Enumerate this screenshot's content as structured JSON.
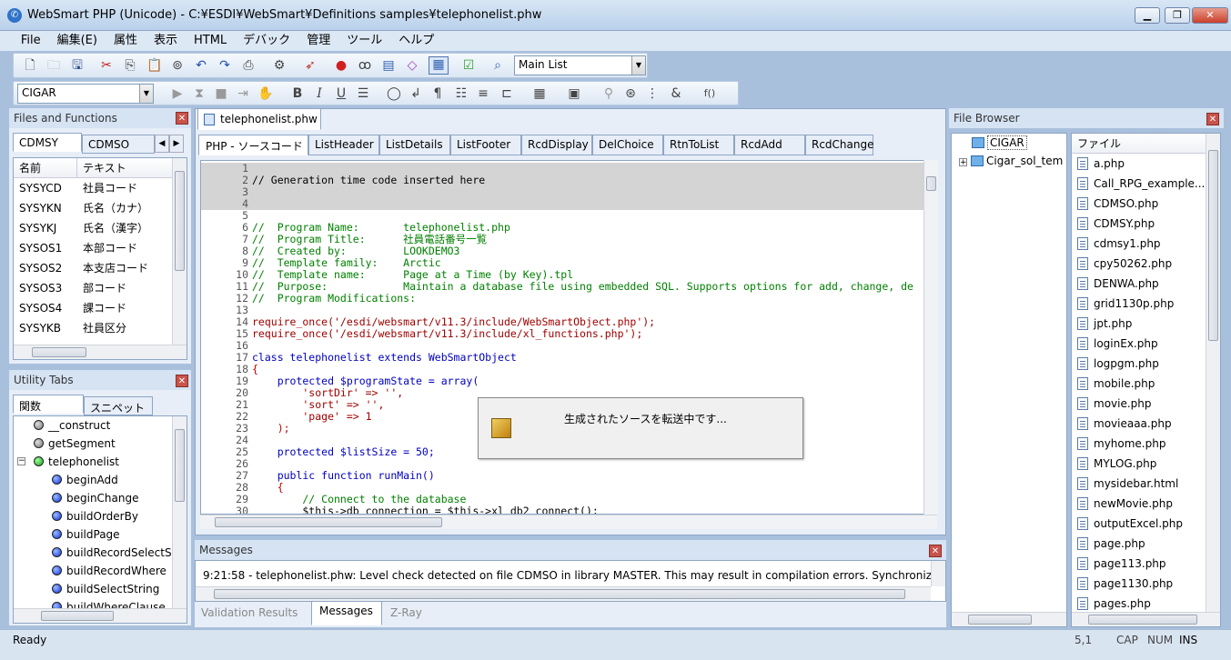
{
  "window": {
    "title": "WebSmart PHP (Unicode) - C:¥ESDI¥WebSmart¥Definitions samples¥telephonelist.phw",
    "app_icon": "websmart-logo-icon"
  },
  "menu": [
    "File",
    "編集(E)",
    "属性",
    "表示",
    "HTML",
    "デバック",
    "管理",
    "ツール",
    "ヘルプ"
  ],
  "toolbar": {
    "list_select_value": "Main List",
    "library_select_value": "CIGAR"
  },
  "files_panel": {
    "title": "Files and Functions",
    "tabs": [
      "CDMSY",
      "CDMSO"
    ],
    "columns": [
      "名前",
      "テキスト"
    ],
    "rows": [
      {
        "name": "SYSYCD",
        "text": "社員コード"
      },
      {
        "name": "SYSYKN",
        "text": "氏名（カナ）"
      },
      {
        "name": "SYSYKJ",
        "text": "氏名（漢字）"
      },
      {
        "name": "SYSOS1",
        "text": "本部コード"
      },
      {
        "name": "SYSOS2",
        "text": "本支店コード"
      },
      {
        "name": "SYSOS3",
        "text": "部コード"
      },
      {
        "name": "SYSOS4",
        "text": "課コード"
      },
      {
        "name": "SYSYKB",
        "text": "社員区分"
      }
    ]
  },
  "utility_panel": {
    "title": "Utility Tabs",
    "tabs": [
      "関数",
      "スニペット"
    ],
    "tree": [
      {
        "label": "__construct",
        "color": "gray",
        "level": 1
      },
      {
        "label": "getSegment",
        "color": "gray",
        "level": 1
      },
      {
        "label": "telephonelist",
        "color": "green",
        "level": 1
      },
      {
        "label": "beginAdd",
        "color": "blue",
        "level": 2
      },
      {
        "label": "beginChange",
        "color": "blue",
        "level": 2
      },
      {
        "label": "buildOrderBy",
        "color": "blue",
        "level": 2
      },
      {
        "label": "buildPage",
        "color": "blue",
        "level": 2
      },
      {
        "label": "buildRecordSelectSt",
        "color": "blue",
        "level": 2
      },
      {
        "label": "buildRecordWhere",
        "color": "blue",
        "level": 2
      },
      {
        "label": "buildSelectString",
        "color": "blue",
        "level": 2
      },
      {
        "label": "buildWhereClause",
        "color": "blue",
        "level": 2
      }
    ]
  },
  "editor": {
    "doc_tab": "telephonelist.phw",
    "segment_tabs": [
      "PHP - ソースコード",
      "ListHeader",
      "ListDetails",
      "ListFooter",
      "RcdDisplay",
      "DelChoice",
      "RtnToList",
      "RcdAdd",
      "RcdChange"
    ],
    "lines": [
      {
        "n": "1",
        "t": "",
        "c": "cv",
        "hl": true
      },
      {
        "n": "2",
        "t": "// Generation time code inserted here",
        "c": "cv",
        "hl": true
      },
      {
        "n": "3",
        "t": "",
        "c": "cv",
        "hl": true
      },
      {
        "n": "4",
        "t": "",
        "c": "cv",
        "hl": true
      },
      {
        "n": "5",
        "t": "",
        "c": "cv",
        "hl": false
      },
      {
        "n": "6",
        "t": "//  Program Name:       telephonelist.php",
        "c": "cc",
        "hl": false
      },
      {
        "n": "7",
        "t": "//  Program Title:      社員電話番号一覧",
        "c": "cc",
        "hl": false
      },
      {
        "n": "8",
        "t": "//  Created by:         LOOKDEMO3",
        "c": "cc",
        "hl": false
      },
      {
        "n": "9",
        "t": "//  Template family:    Arctic",
        "c": "cc",
        "hl": false
      },
      {
        "n": "10",
        "t": "//  Template name:      Page at a Time (by Key).tpl",
        "c": "cc",
        "hl": false
      },
      {
        "n": "11",
        "t": "//  Purpose:            Maintain a database file using embedded SQL. Supports options for add, change, de",
        "c": "cc",
        "hl": false
      },
      {
        "n": "12",
        "t": "//  Program Modifications:",
        "c": "cc",
        "hl": false
      },
      {
        "n": "13",
        "t": "",
        "c": "cv",
        "hl": false
      },
      {
        "n": "14",
        "t": "require_once('/esdi/websmart/v11.3/include/WebSmartObject.php');",
        "c": "cs",
        "hl": false
      },
      {
        "n": "15",
        "t": "require_once('/esdi/websmart/v11.3/include/xl_functions.php');",
        "c": "cs",
        "hl": false
      },
      {
        "n": "16",
        "t": "",
        "c": "cv",
        "hl": false
      },
      {
        "n": "17",
        "t": "class telephonelist extends WebSmartObject",
        "c": "ck",
        "hl": false
      },
      {
        "n": "18",
        "t": "{",
        "c": "co",
        "hl": false
      },
      {
        "n": "19",
        "t": "    protected $programState = array(",
        "c": "ck",
        "hl": false
      },
      {
        "n": "20",
        "t": "        'sortDir' => '',",
        "c": "cs",
        "hl": false
      },
      {
        "n": "21",
        "t": "        'sort' => '',",
        "c": "cs",
        "hl": false
      },
      {
        "n": "22",
        "t": "        'page' => 1",
        "c": "cs",
        "hl": false
      },
      {
        "n": "23",
        "t": "    );",
        "c": "co",
        "hl": false
      },
      {
        "n": "24",
        "t": "",
        "c": "cv",
        "hl": false
      },
      {
        "n": "25",
        "t": "    protected $listSize = 50;",
        "c": "ck",
        "hl": false
      },
      {
        "n": "26",
        "t": "",
        "c": "cv",
        "hl": false
      },
      {
        "n": "27",
        "t": "    public function runMain()",
        "c": "ck",
        "hl": false
      },
      {
        "n": "28",
        "t": "    {",
        "c": "co",
        "hl": false
      },
      {
        "n": "29",
        "t": "        // Connect to the database",
        "c": "cc",
        "hl": false
      },
      {
        "n": "30",
        "t": "        $this->db_connection = $this->xl_db2_connect();",
        "c": "cv",
        "hl": false
      }
    ]
  },
  "dialog": {
    "message": "生成されたソースを転送中です..."
  },
  "messages_panel": {
    "title": "Messages",
    "text": "9:21:58 - telephonelist.phw: Level check detected on file CDMSO in library MASTER.  This may result in compilation errors.  Synchronize",
    "tabs": [
      "Validation Results",
      "Messages",
      "Z-Ray"
    ]
  },
  "file_browser": {
    "title": "File Browser",
    "tree": [
      "CIGAR",
      "Cigar_sol_tem"
    ],
    "column": "ファイル",
    "files": [
      "a.php",
      "Call_RPG_example....",
      "CDMSO.php",
      "CDMSY.php",
      "cdmsy1.php",
      "cpy50262.php",
      "DENWA.php",
      "grid1130p.php",
      "jpt.php",
      "loginEx.php",
      "logpgm.php",
      "mobile.php",
      "movie.php",
      "movieaaa.php",
      "myhome.php",
      "MYLOG.php",
      "mysidebar.html",
      "newMovie.php",
      "outputExcel.php",
      "page.php",
      "page113.php",
      "page1130.php",
      "pages.php"
    ]
  },
  "status": {
    "text": "Ready",
    "pos": "5,1",
    "cap": "CAP",
    "num": "NUM",
    "ins": "INS"
  }
}
